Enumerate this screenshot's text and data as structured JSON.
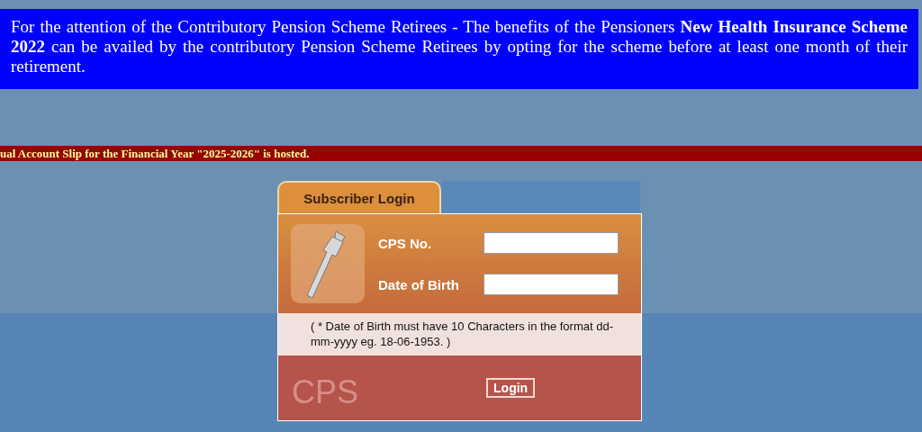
{
  "notice": {
    "text": "For the attention of the Contributory Pension Scheme Retirees - The benefits of the Pensioners **New Health Insurance Scheme 2022** can be availed by the contributory Pension Scheme Retirees by opting for the scheme before at least one month of their retirement."
  },
  "ticker": {
    "text": "ual Account Slip for the Financial Year \"2025-2026\" is hosted."
  },
  "login": {
    "tab": "Subscriber Login",
    "fields": [
      {
        "label": "CPS No."
      },
      {
        "label": "Date of Birth"
      }
    ],
    "hint": "( * Date of Birth must have 10 Characters in the format dd-mm-yyyy eg. 18-06-1953. )",
    "watermark": "CPS",
    "button": "Login"
  }
}
